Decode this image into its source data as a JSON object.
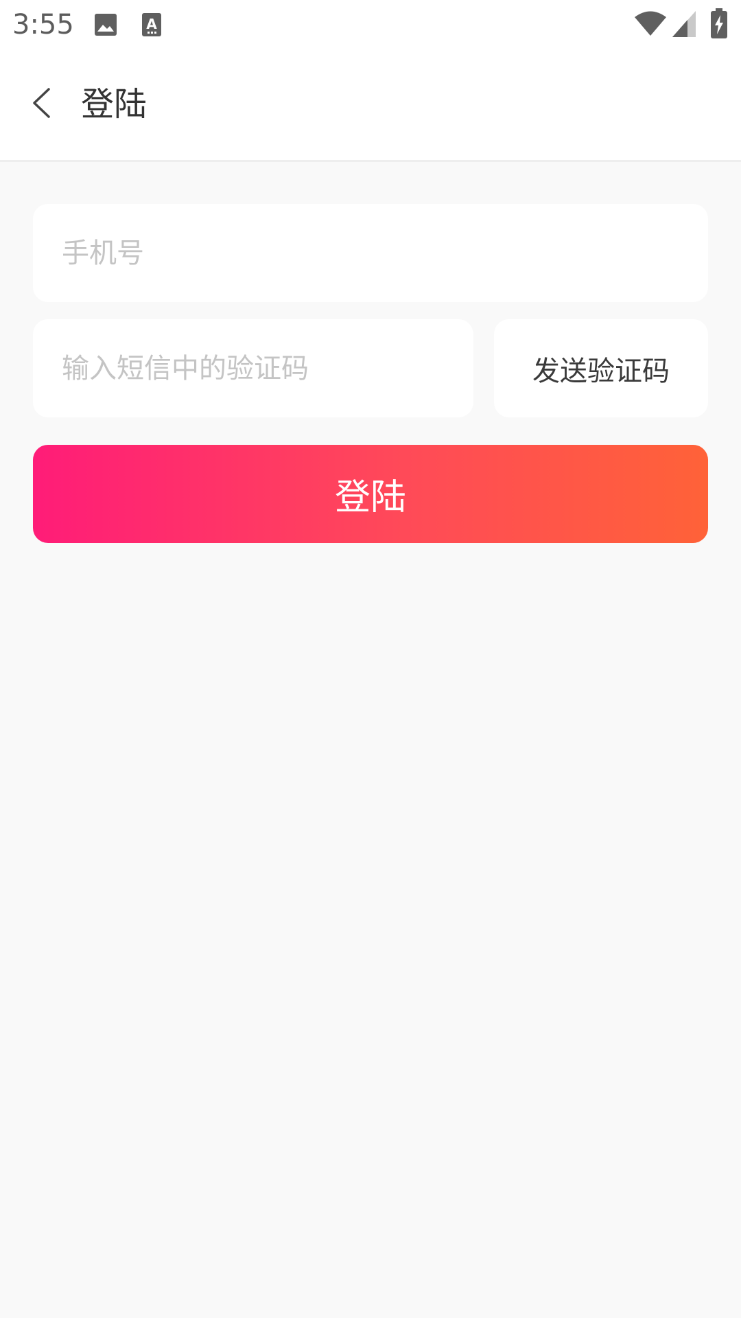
{
  "status_bar": {
    "time": "3:55",
    "icons": [
      "image-icon",
      "text-recognition-icon",
      "wifi-icon",
      "cell-signal-icon",
      "battery-charging-icon"
    ]
  },
  "header": {
    "back_icon": "back-arrow-icon",
    "title": "登陆"
  },
  "form": {
    "phone_placeholder": "手机号",
    "phone_value": "",
    "code_placeholder": "输入短信中的验证码",
    "code_value": "",
    "send_code_label": "发送验证码",
    "login_label": "登陆"
  },
  "colors": {
    "gradient_start": "#ff1c78",
    "gradient_end": "#ff6238",
    "background": "#f9f9f9"
  }
}
